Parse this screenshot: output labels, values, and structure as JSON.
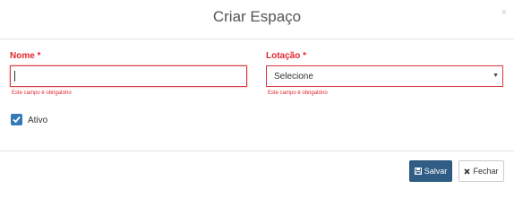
{
  "modal": {
    "title": "Criar Espaço",
    "close_symbol": "×"
  },
  "form": {
    "nome": {
      "label": "Nome *",
      "value": "",
      "help": "Este campo é obrigatório"
    },
    "lotacao": {
      "label": "Lotação *",
      "selected": "Selecione",
      "help": "Este campo é obrigatório",
      "caret_icon": "caret-down-icon"
    },
    "ativo": {
      "label": "Ativo",
      "checked": true,
      "icon": "checkmark-icon"
    }
  },
  "footer": {
    "save_label": "Salvar",
    "save_icon": "floppy-disk-icon",
    "close_label": "Fechar",
    "close_icon": "close-icon"
  },
  "colors": {
    "error": "#e2262d",
    "primary": "#2f5d85",
    "checkbox": "#337ab7"
  }
}
